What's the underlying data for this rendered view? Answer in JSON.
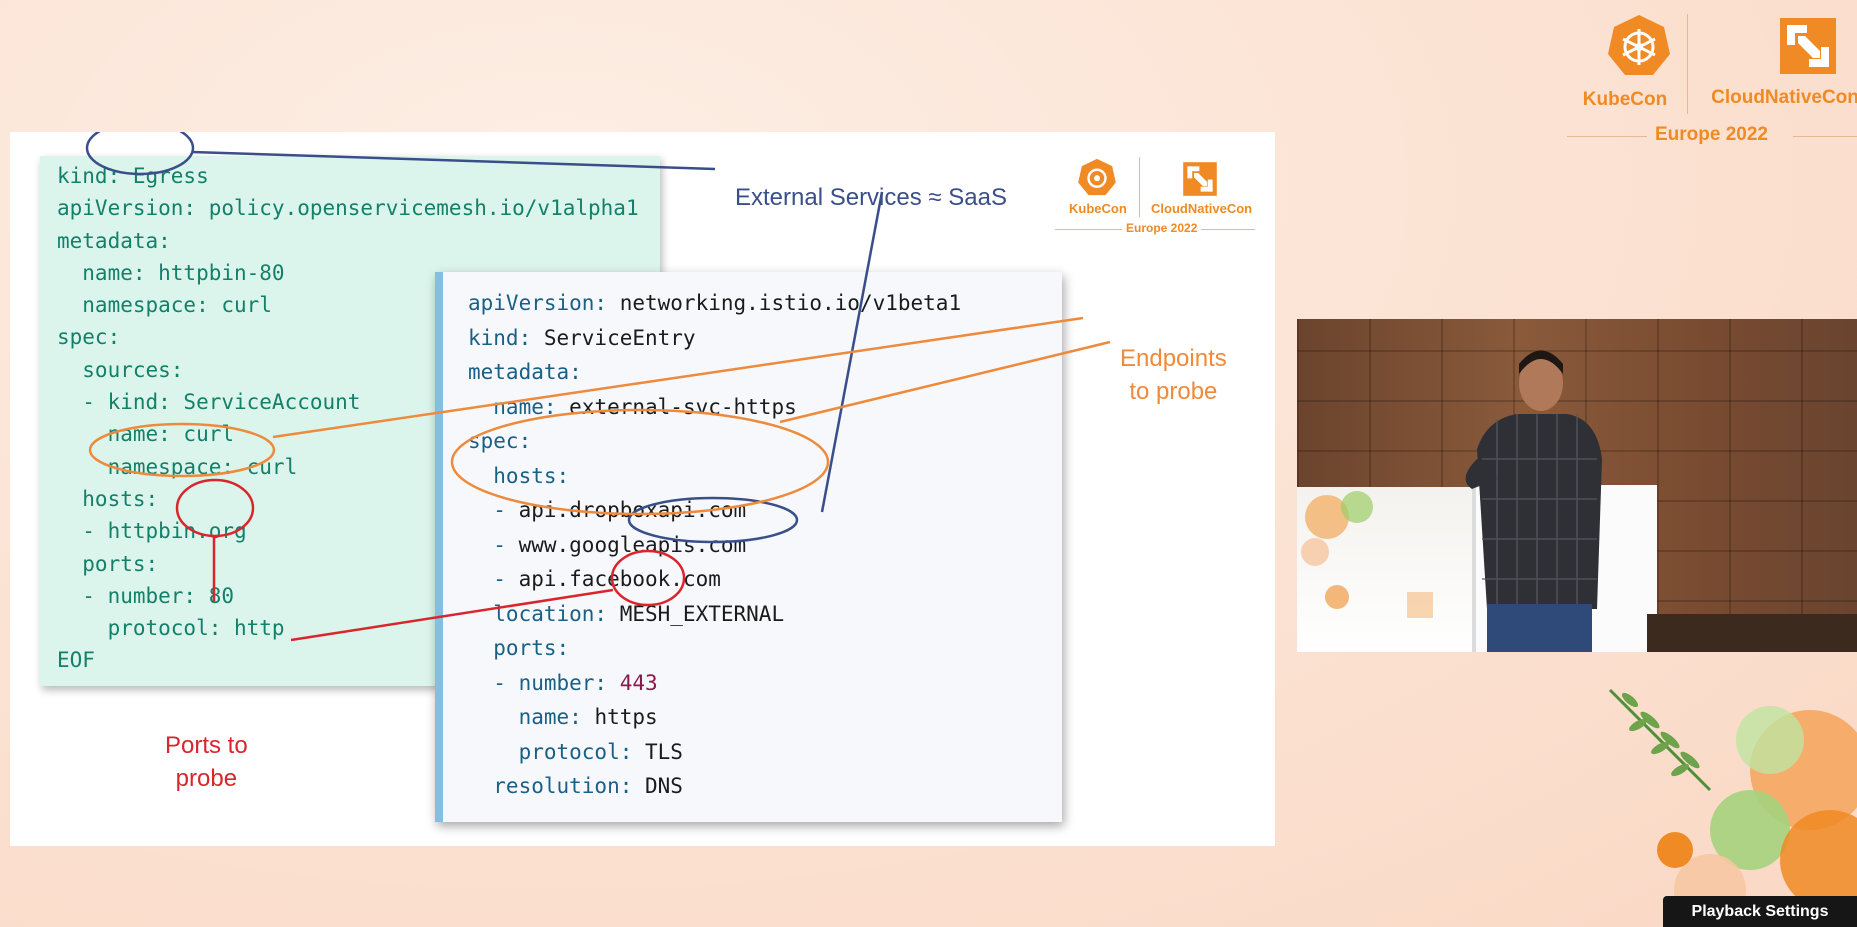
{
  "conference": {
    "kubecon": "KubeCon",
    "cloudnativecon": "CloudNativeCon",
    "edition": "Europe 2022"
  },
  "slide": {
    "egress_yaml": "kind: Egress\napiVersion: policy.openservicemesh.io/v1alpha1\nmetadata:\n  name: httpbin-80\n  namespace: curl\nspec:\n  sources:\n  - kind: ServiceAccount\n    name: curl\n    namespace: curl\n  hosts:\n  - httpbin.org\n  ports:\n  - number: 80\n    protocol: http\nEOF",
    "service_entry_lines": [
      {
        "key": "apiVersion:",
        "val": " networking.istio.io/v1beta1"
      },
      {
        "key": "kind:",
        "val": " ServiceEntry"
      },
      {
        "key": "metadata:",
        "val": ""
      },
      {
        "key": "  name:",
        "val": " external-svc-https"
      },
      {
        "key": "spec:",
        "val": ""
      },
      {
        "key": "  hosts:",
        "val": ""
      },
      {
        "key": "  -",
        "val": " api.dropboxapi.com"
      },
      {
        "key": "  -",
        "val": " www.googleapis.com"
      },
      {
        "key": "  -",
        "val": " api.facebook.com"
      },
      {
        "key": "  location:",
        "val": " MESH_EXTERNAL"
      },
      {
        "key": "  ports:",
        "val": ""
      },
      {
        "key": "  - number:",
        "val": " 443",
        "num": true
      },
      {
        "key": "    name:",
        "val": " https"
      },
      {
        "key": "    protocol:",
        "val": " TLS"
      },
      {
        "key": "  resolution:",
        "val": " DNS"
      }
    ],
    "annotations": {
      "external_services": "External Services ≈ SaaS",
      "endpoints_line1": "Endpoints",
      "endpoints_line2": "to probe",
      "ports_line1": "Ports to",
      "ports_line2": "probe"
    },
    "colors": {
      "blue": "#3a4f8a",
      "orange": "#ee8a3b",
      "red": "#d8262c"
    }
  },
  "player": {
    "playback_settings": "Playback Settings"
  },
  "icons": [
    "kubecon-logo-icon",
    "cncf-logo-icon",
    "speaker-video"
  ]
}
